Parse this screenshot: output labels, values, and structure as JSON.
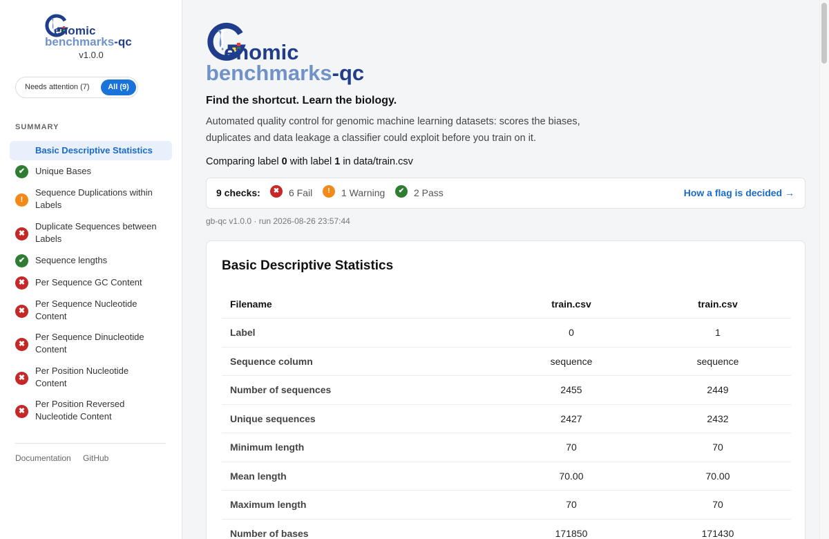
{
  "app": {
    "name_part1": "enomic",
    "name_part2": "benchmarks",
    "name_suffix": "-qc",
    "version": "v1.0.0"
  },
  "filter": {
    "needs_attention_label": "Needs attention (7)",
    "all_label": "All (9)"
  },
  "sidebar": {
    "summary_heading": "SUMMARY",
    "items": [
      {
        "label": "Basic Descriptive Statistics",
        "status": "none",
        "active": true
      },
      {
        "label": "Unique Bases",
        "status": "pass"
      },
      {
        "label": "Sequence Duplications within Labels",
        "status": "warn"
      },
      {
        "label": "Duplicate Sequences between Labels",
        "status": "fail"
      },
      {
        "label": "Sequence lengths",
        "status": "pass"
      },
      {
        "label": "Per Sequence GC Content",
        "status": "fail"
      },
      {
        "label": "Per Sequence Nucleotide Content",
        "status": "fail"
      },
      {
        "label": "Per Sequence Dinucleotide Content",
        "status": "fail"
      },
      {
        "label": "Per Position Nucleotide Content",
        "status": "fail"
      },
      {
        "label": "Per Position Reversed Nucleotide Content",
        "status": "fail"
      }
    ],
    "links": {
      "documentation": "Documentation",
      "github": "GitHub"
    }
  },
  "main": {
    "tagline": "Find the shortcut. Learn the biology.",
    "description": "Automated quality control for genomic machine learning datasets: scores the biases, duplicates and data leakage a classifier could exploit before you train on it.",
    "compare": {
      "prefix": "Comparing label ",
      "label_a": "0",
      "middle": " with label ",
      "label_b": "1",
      "suffix": " in data/train.csv"
    },
    "checks": {
      "count_label": "9 checks:",
      "fail_label": "6 Fail",
      "warning_label": "1 Warning",
      "pass_label": "2 Pass",
      "flag_link": "How a flag is decided →"
    },
    "run_info": "gb-qc v1.0.0 · run 2026-08-26 23:57:44"
  },
  "stats": {
    "title": "Basic Descriptive Statistics",
    "headers": [
      "Filename",
      "train.csv",
      "train.csv"
    ],
    "rows": [
      [
        "Label",
        "0",
        "1"
      ],
      [
        "Sequence column",
        "sequence",
        "sequence"
      ],
      [
        "Number of sequences",
        "2455",
        "2449"
      ],
      [
        "Unique sequences",
        "2427",
        "2432"
      ],
      [
        "Minimum length",
        "70",
        "70"
      ],
      [
        "Mean length",
        "70.00",
        "70.00"
      ],
      [
        "Maximum length",
        "70",
        "70"
      ],
      [
        "Number of bases",
        "171850",
        "171430"
      ]
    ]
  },
  "icons": {
    "pass": "✔",
    "fail": "✖",
    "warn": "!"
  },
  "colors": {
    "accent": "#1a73d9",
    "pass": "#2e7d32",
    "fail": "#c62828",
    "warn": "#f28a1a",
    "brand_dark": "#1f3d8a",
    "brand_light": "#6f93c9"
  }
}
